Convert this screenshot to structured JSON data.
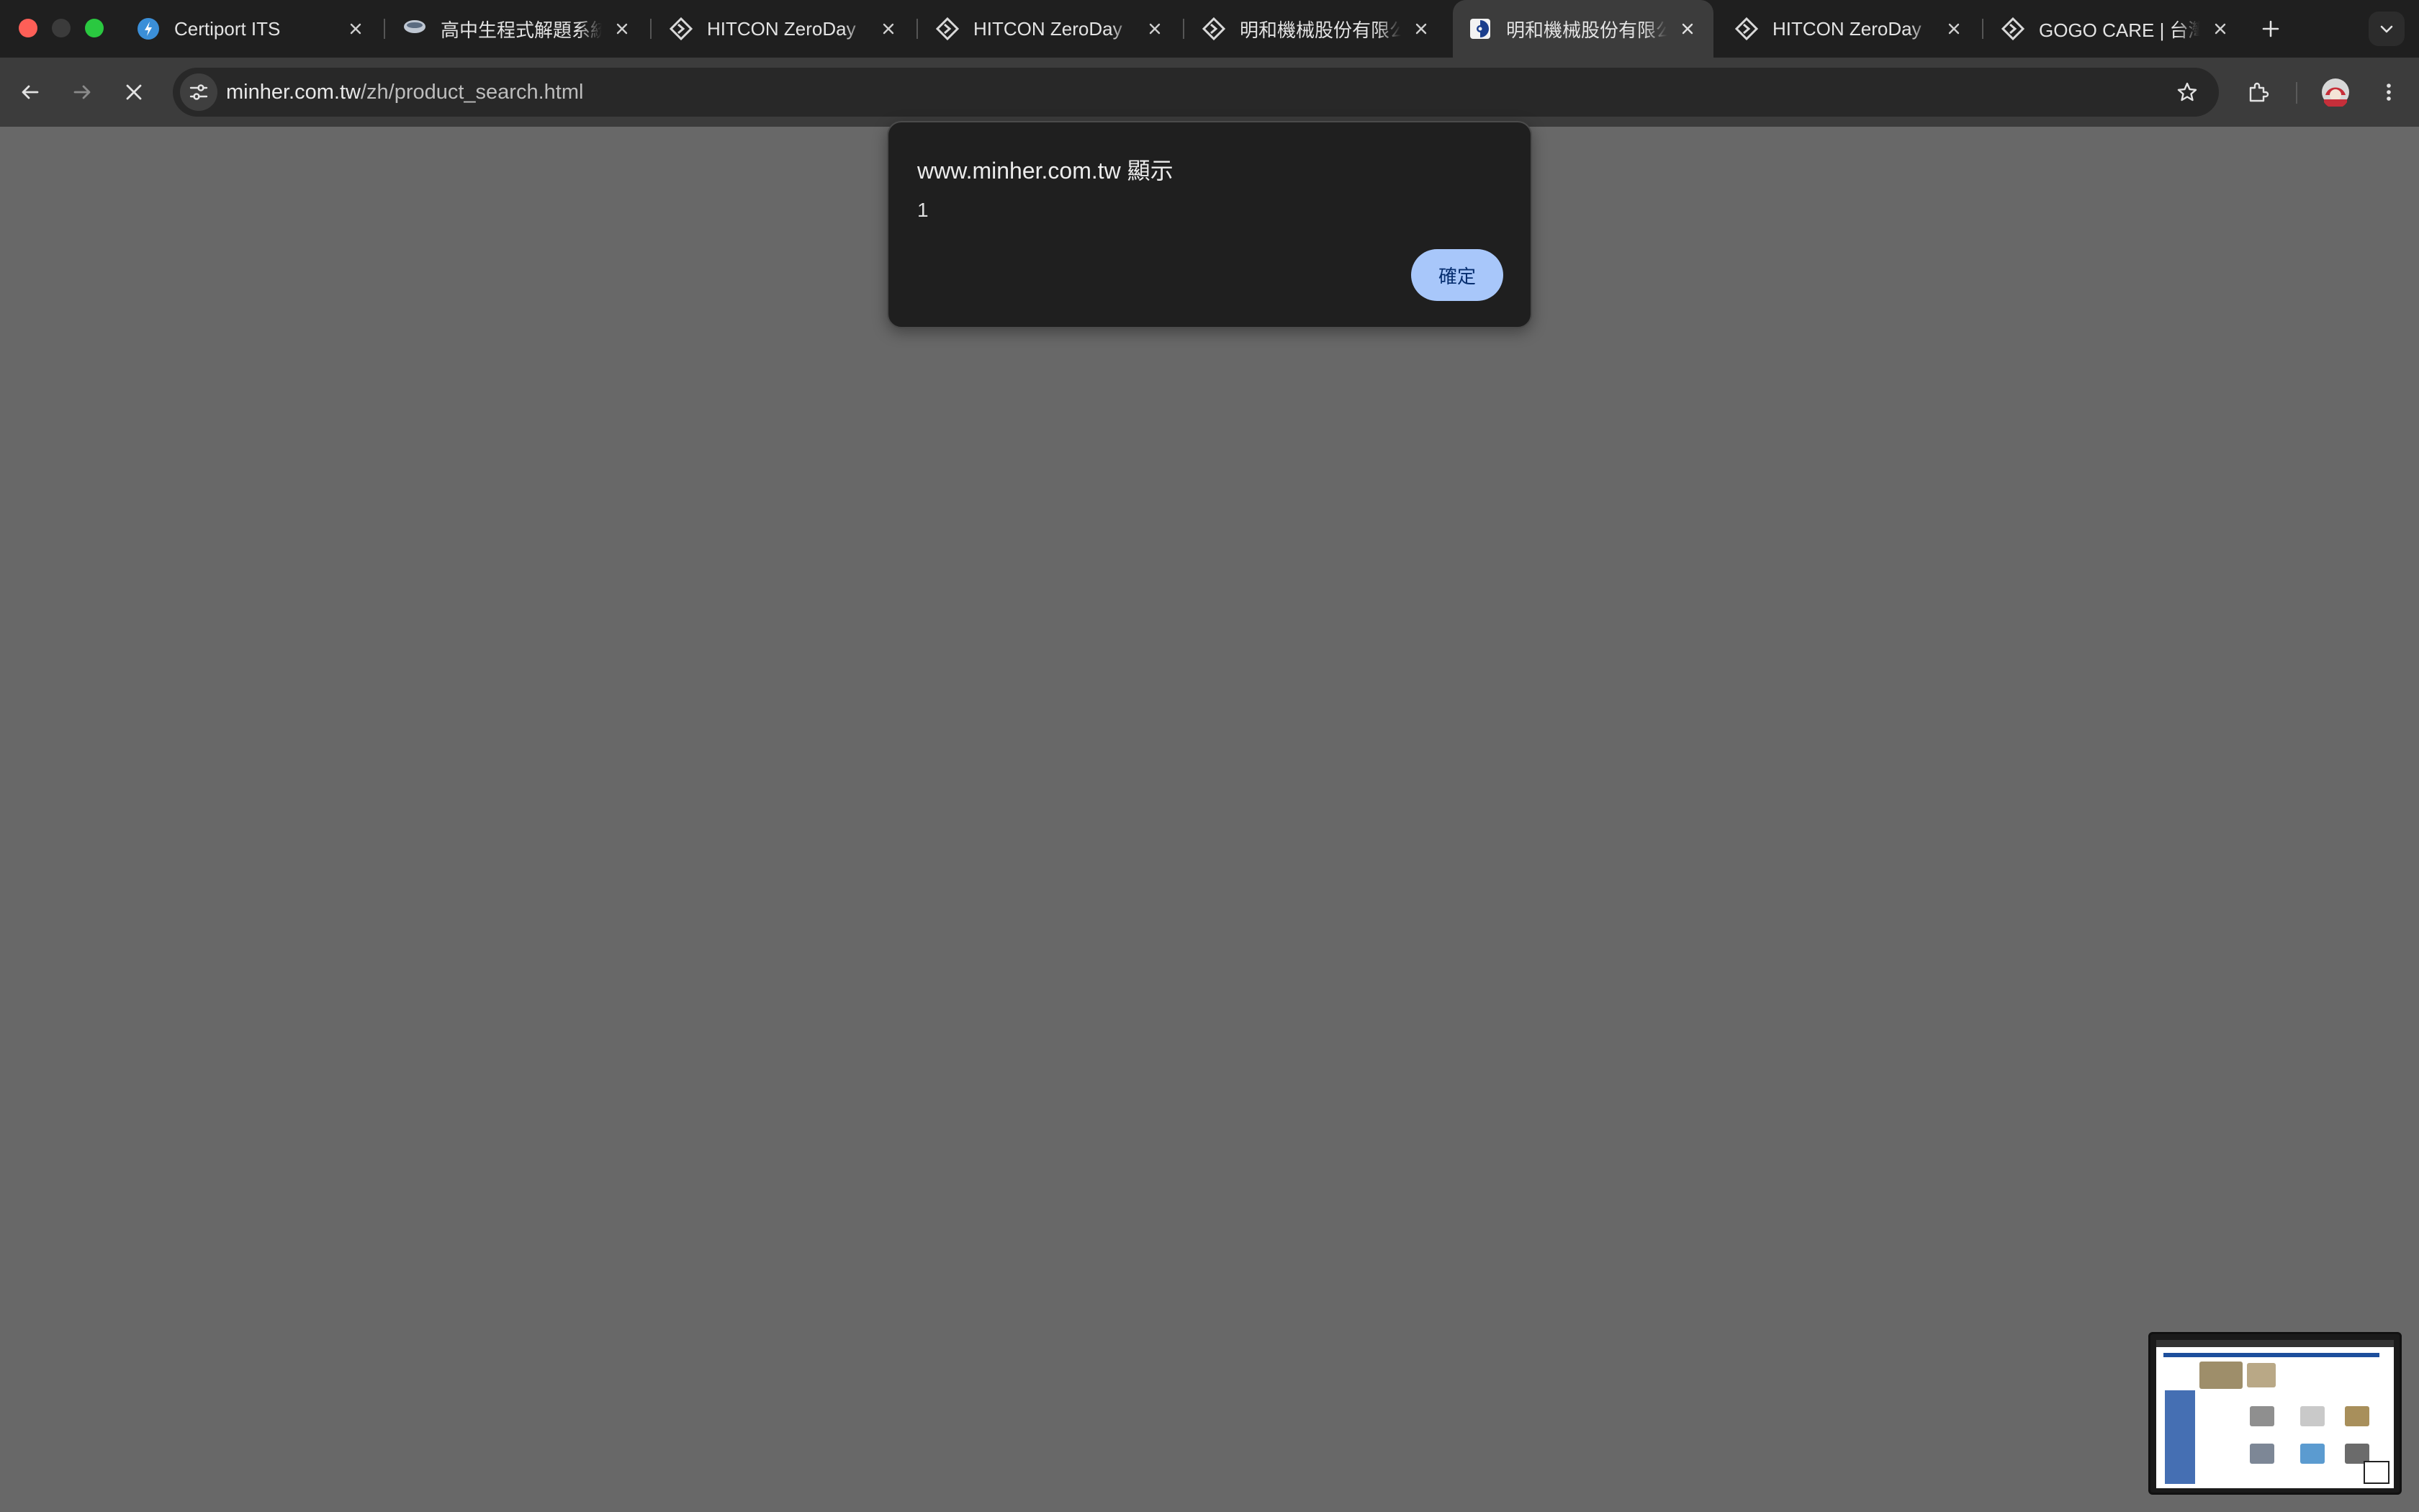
{
  "window": {
    "controls": [
      "close",
      "minimize",
      "zoom"
    ]
  },
  "tabs": [
    {
      "title": "Certiport ITS",
      "icon": "certiport-icon",
      "active": false
    },
    {
      "title": "高中生程式解題系統",
      "icon": "zerojudge-icon",
      "active": false
    },
    {
      "title": "HITCON ZeroDay",
      "icon": "hitcon-icon",
      "active": false
    },
    {
      "title": "HITCON ZeroDay",
      "icon": "hitcon-icon",
      "active": false
    },
    {
      "title": "明和機械股份有限公司",
      "icon": "hitcon-icon",
      "active": false
    },
    {
      "title": "明和機械股份有限公司",
      "icon": "minher-icon",
      "active": true
    },
    {
      "title": "HITCON ZeroDay",
      "icon": "hitcon-icon",
      "active": false
    },
    {
      "title": "GOGO CARE | 台灣銀髮",
      "icon": "hitcon-icon",
      "active": false
    }
  ],
  "toolbar": {
    "url_host": "minher.com.tw",
    "url_path": "/zh/product_search.html",
    "loading": true
  },
  "dialog": {
    "title": "www.minher.com.tw 顯示",
    "message": "1",
    "ok_label": "確定"
  },
  "colors": {
    "page_background": "#686868",
    "tabstrip": "#1f1f1f",
    "toolbar": "#3c3c3c",
    "ok_button": "#a8c7fa"
  }
}
